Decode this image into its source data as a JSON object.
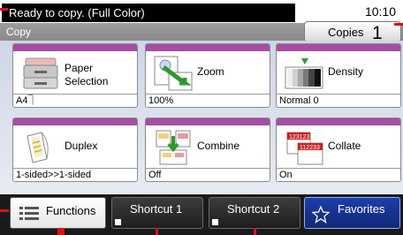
{
  "status": {
    "message": "Ready to copy. (Full Color)",
    "time": "10:10"
  },
  "title": {
    "label": "Copy"
  },
  "copies": {
    "label": "Copies",
    "count": "1"
  },
  "tiles": [
    {
      "name": "Paper\nSelection",
      "value": "A4⏋",
      "icon": "paper-tray-icon"
    },
    {
      "name": "Zoom",
      "value": "100%",
      "icon": "zoom-icon"
    },
    {
      "name": "Density",
      "value": "Normal 0",
      "icon": "density-icon"
    },
    {
      "name": "Duplex",
      "value": "1-sided>>1-sided",
      "icon": "duplex-icon"
    },
    {
      "name": "Combine",
      "value": "Off",
      "icon": "combine-icon"
    },
    {
      "name": "Collate",
      "value": "On",
      "icon": "collate-icon"
    }
  ],
  "bottom": {
    "functions_label": "Functions",
    "shortcut1_label": "Shortcut 1",
    "shortcut2_label": "Shortcut 2",
    "favorites_label": "Favorites"
  },
  "colors": {
    "accent": "#a44fa4",
    "favorites": "#1c3ea8",
    "marker": "#dd1111"
  }
}
